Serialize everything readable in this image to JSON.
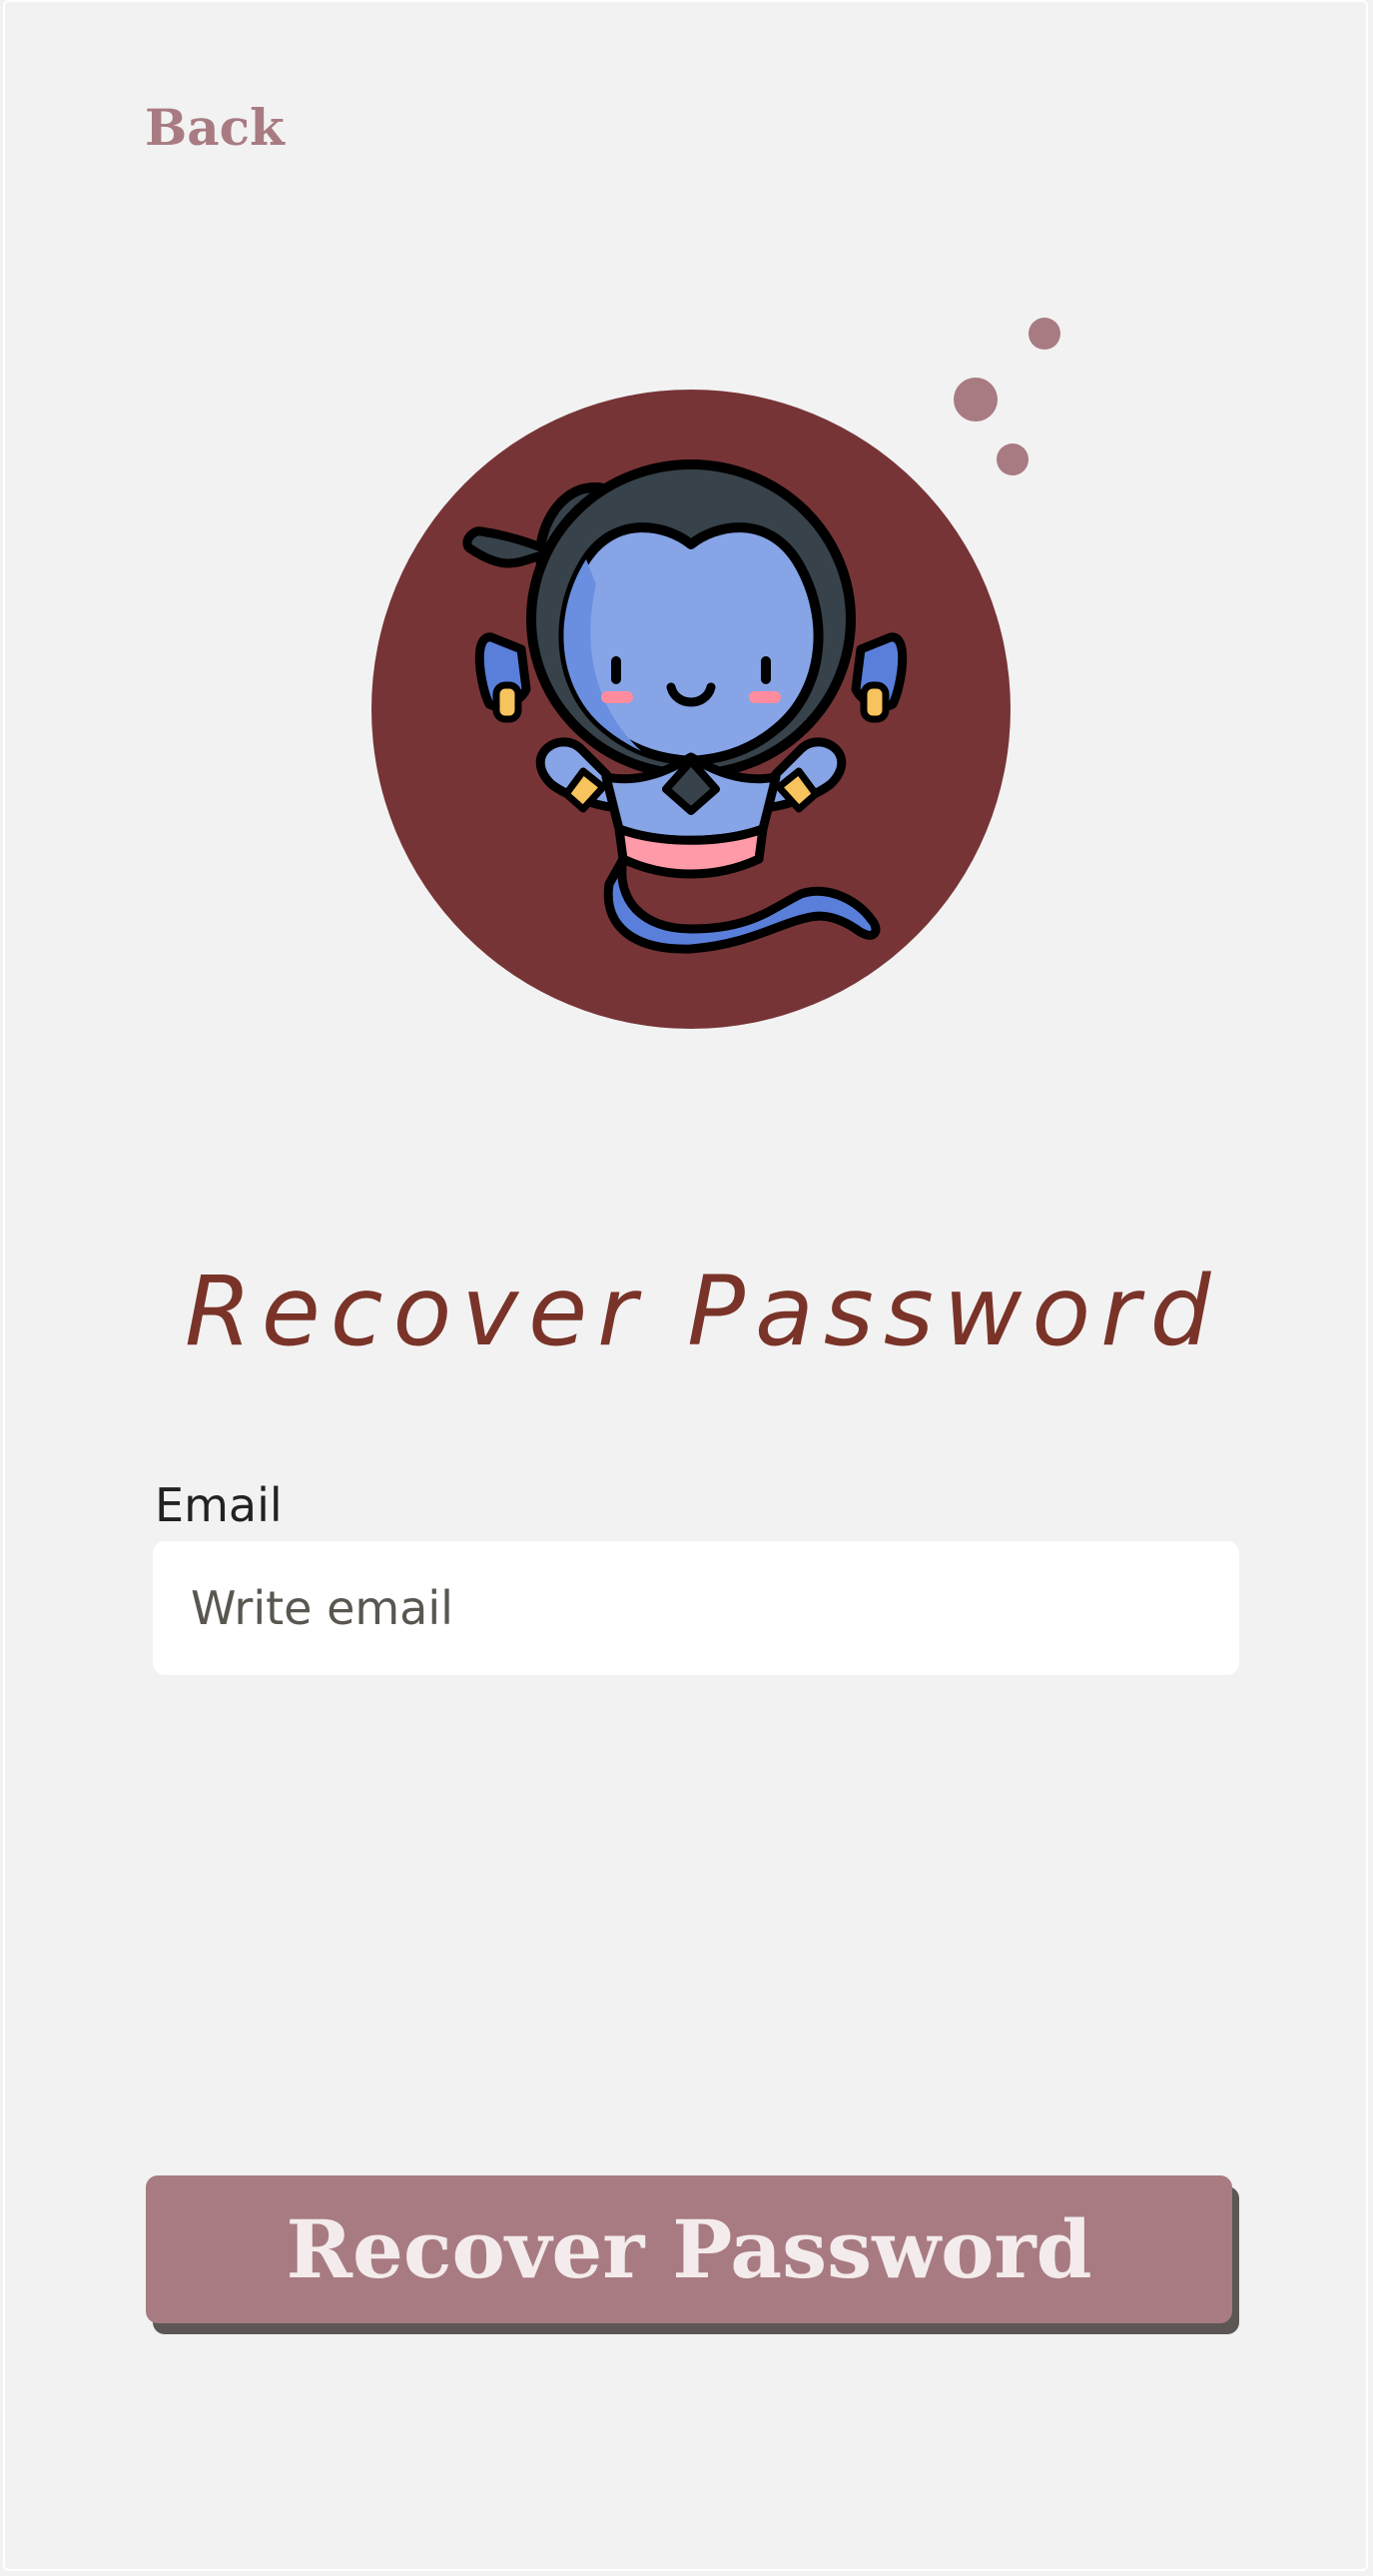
{
  "nav": {
    "back_label": "Back"
  },
  "page": {
    "title": "Recover Password"
  },
  "form": {
    "email_label": "Email",
    "email_placeholder": "Write email",
    "email_value": ""
  },
  "actions": {
    "recover_label": "Recover Password"
  },
  "colors": {
    "background": "#f2f2f2",
    "accent": "#a87b82",
    "avatar_circle": "#773436",
    "title": "#7a3328",
    "button_shadow": "#5c5754"
  },
  "icons": {
    "avatar": "genie-icon",
    "decor": "bubble-dots"
  }
}
